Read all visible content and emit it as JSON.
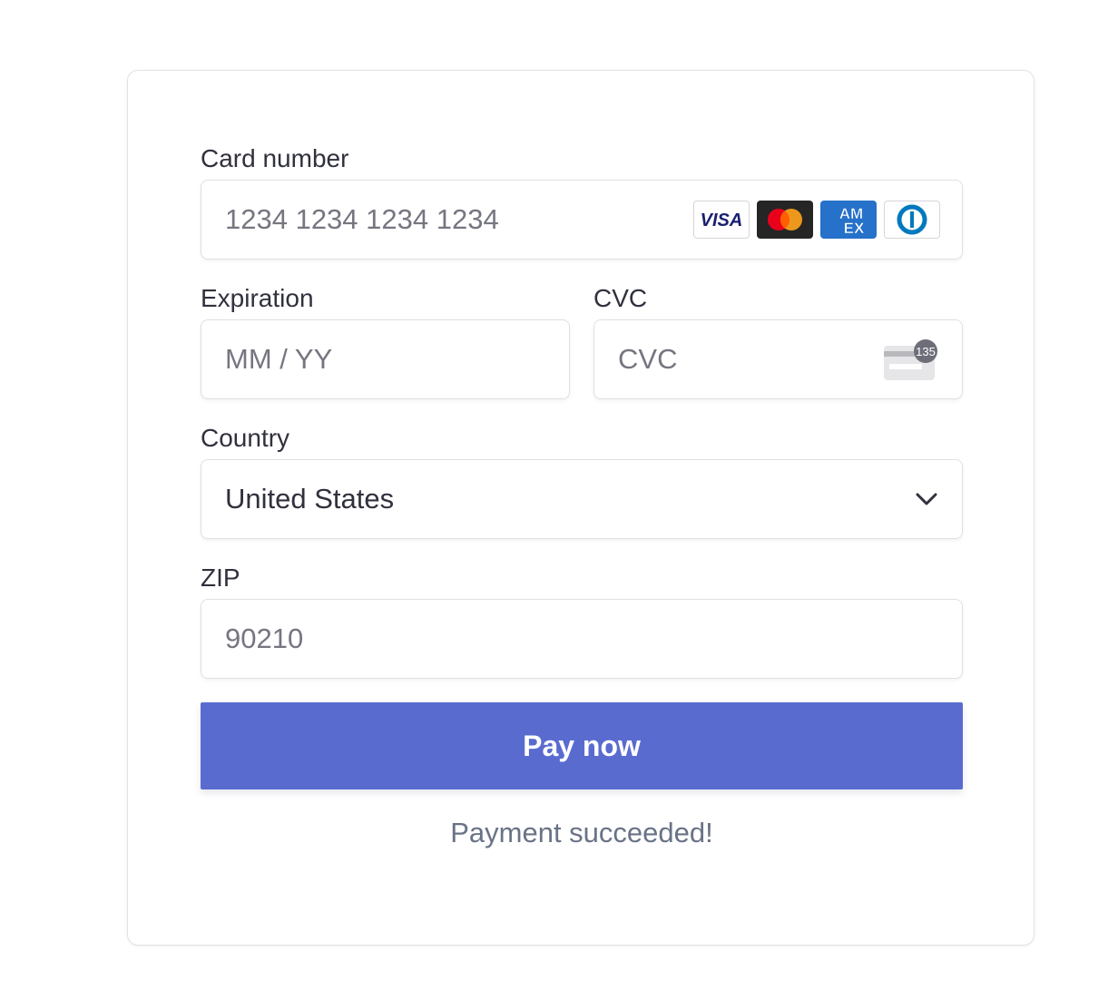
{
  "form": {
    "card_number": {
      "label": "Card number",
      "placeholder": "1234 1234 1234 1234",
      "brands": [
        {
          "name": "visa",
          "text": "VISA",
          "color": "#1a1f71"
        },
        {
          "name": "mastercard",
          "colors": [
            "#eb001b",
            "#f79e1b"
          ]
        },
        {
          "name": "amex",
          "text_top": "AM",
          "text_bottom": "EX",
          "color": "#2671c9"
        },
        {
          "name": "diners",
          "color": "#0079be"
        }
      ]
    },
    "expiration": {
      "label": "Expiration",
      "placeholder": "MM / YY"
    },
    "cvc": {
      "label": "CVC",
      "placeholder": "CVC",
      "icon_badge": "135"
    },
    "country": {
      "label": "Country",
      "value": "United States"
    },
    "zip": {
      "label": "ZIP",
      "placeholder": "90210"
    }
  },
  "pay_button": {
    "label": "Pay now",
    "color": "#5a6bd0"
  },
  "status_message": "Payment succeeded!"
}
